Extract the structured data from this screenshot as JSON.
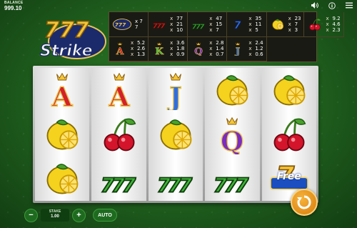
{
  "balance": {
    "label": "BALANCE",
    "value": "999.10"
  },
  "top_icons": [
    "speaker-icon",
    "info-icon",
    "menu-icon"
  ],
  "logo": {
    "text_top": "777",
    "text_bottom": "Strike"
  },
  "paytable": [
    {
      "symbol": "wild-777-logo",
      "pays": [
        [
          "",
          "7"
        ],
        [
          "",
          "7"
        ],
        [
          "",
          ""
        ]
      ],
      "first_line": "x 7 7"
    },
    {
      "symbol": "red-777",
      "pays": [
        [
          "x",
          "77"
        ],
        [
          "x",
          "21"
        ],
        [
          "x",
          "10"
        ]
      ]
    },
    {
      "symbol": "green-777",
      "pays": [
        [
          "x",
          "47"
        ],
        [
          "x",
          "15"
        ],
        [
          "x",
          "7"
        ]
      ]
    },
    {
      "symbol": "blue-7",
      "pays": [
        [
          "x",
          "35"
        ],
        [
          "x",
          "11"
        ],
        [
          "x",
          "5"
        ]
      ]
    },
    {
      "symbol": "lemon",
      "pays": [
        [
          "x",
          "23"
        ],
        [
          "x",
          "7"
        ],
        [
          "x",
          "3"
        ]
      ]
    },
    {
      "symbol": "cherry",
      "pays": [
        [
          "x",
          "9.2"
        ],
        [
          "x",
          "4.6"
        ],
        [
          "x",
          "2.3"
        ]
      ]
    },
    {
      "symbol": "letter-a",
      "pays": [
        [
          "x",
          "5.2"
        ],
        [
          "x",
          "2.6"
        ],
        [
          "x",
          "1.3"
        ]
      ]
    },
    {
      "symbol": "letter-k",
      "pays": [
        [
          "x",
          "3.6"
        ],
        [
          "x",
          "1.8"
        ],
        [
          "x",
          "0.9"
        ]
      ]
    },
    {
      "symbol": "letter-q",
      "pays": [
        [
          "x",
          "2.8"
        ],
        [
          "x",
          "1.4"
        ],
        [
          "x",
          "0.7"
        ]
      ]
    },
    {
      "symbol": "letter-j",
      "pays": [
        [
          "x",
          "2.4"
        ],
        [
          "x",
          "1.2"
        ],
        [
          "x",
          "0.6"
        ]
      ]
    }
  ],
  "reels": [
    [
      "A",
      "lemon",
      "lemon"
    ],
    [
      "A",
      "cherry",
      "777"
    ],
    [
      "J",
      "lemon",
      "777"
    ],
    [
      "lemon",
      "Q",
      "777"
    ],
    [
      "lemon",
      "cherry",
      "free"
    ]
  ],
  "free_text": "Free",
  "stake": {
    "label": "STAKE",
    "value": "1.00"
  },
  "controls": {
    "minus": "−",
    "plus": "+",
    "auto": "AUTO"
  }
}
